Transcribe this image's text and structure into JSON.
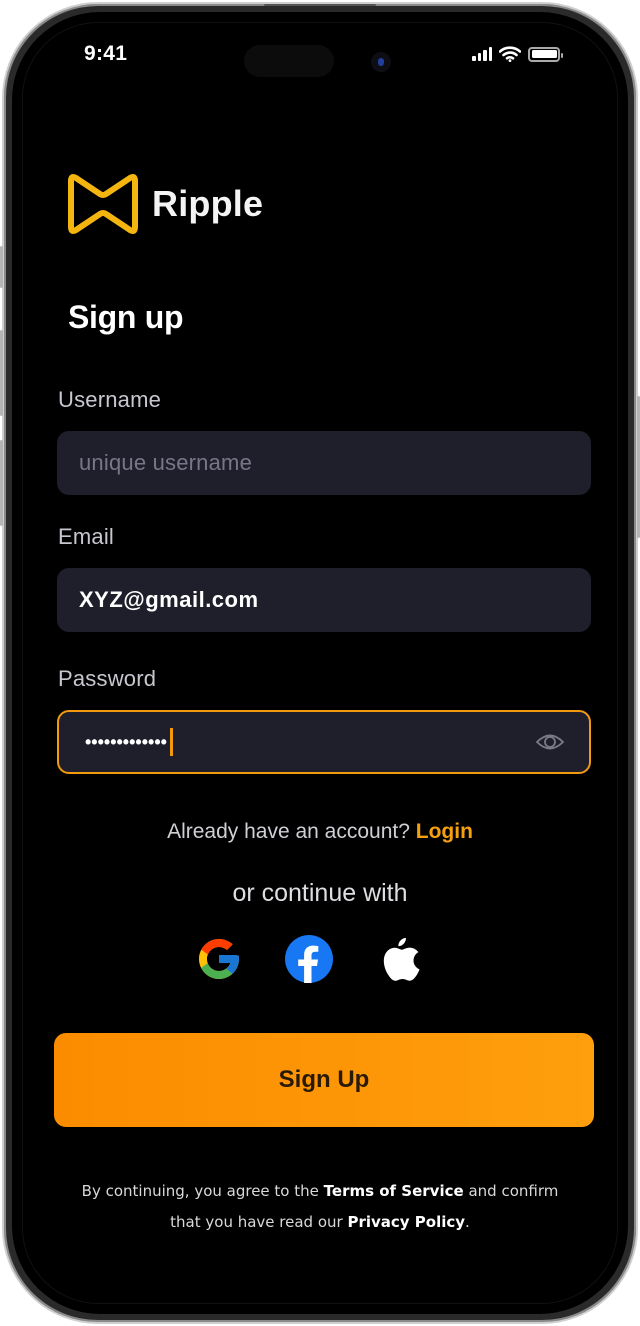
{
  "status_bar": {
    "time": "9:41",
    "icons": [
      "cellular-signal-icon",
      "wifi-icon",
      "battery-icon"
    ]
  },
  "brand": {
    "name": "Ripple",
    "logo_icon": "ripple-bowtie-logo-icon",
    "accent_color": "#f5a00f"
  },
  "page": {
    "title": "Sign up"
  },
  "form": {
    "username": {
      "label": "Username",
      "value": "",
      "placeholder": "unique username"
    },
    "email": {
      "label": "Email",
      "value": "XYZ@gmail.com",
      "placeholder": ""
    },
    "password": {
      "label": "Password",
      "masked_value": "•••••••••••••",
      "toggle_icon": "eye-icon",
      "focused": true
    }
  },
  "login_prompt": {
    "text": "Already have an account?",
    "link": "Login"
  },
  "social": {
    "heading": "or continue with",
    "providers": [
      {
        "name": "Google",
        "icon": "google-icon"
      },
      {
        "name": "Facebook",
        "icon": "facebook-icon"
      },
      {
        "name": "Apple",
        "icon": "apple-icon"
      }
    ]
  },
  "cta": {
    "label": "Sign Up",
    "colors": [
      "#fb8c00",
      "#ff9f0d"
    ]
  },
  "legal": {
    "part1": "By continuing, you agree to the",
    "terms_link": "Terms of Service",
    "part2": "and confirm",
    "part3": "that you have read our",
    "privacy_link": "Privacy Policy",
    "part4": "."
  }
}
